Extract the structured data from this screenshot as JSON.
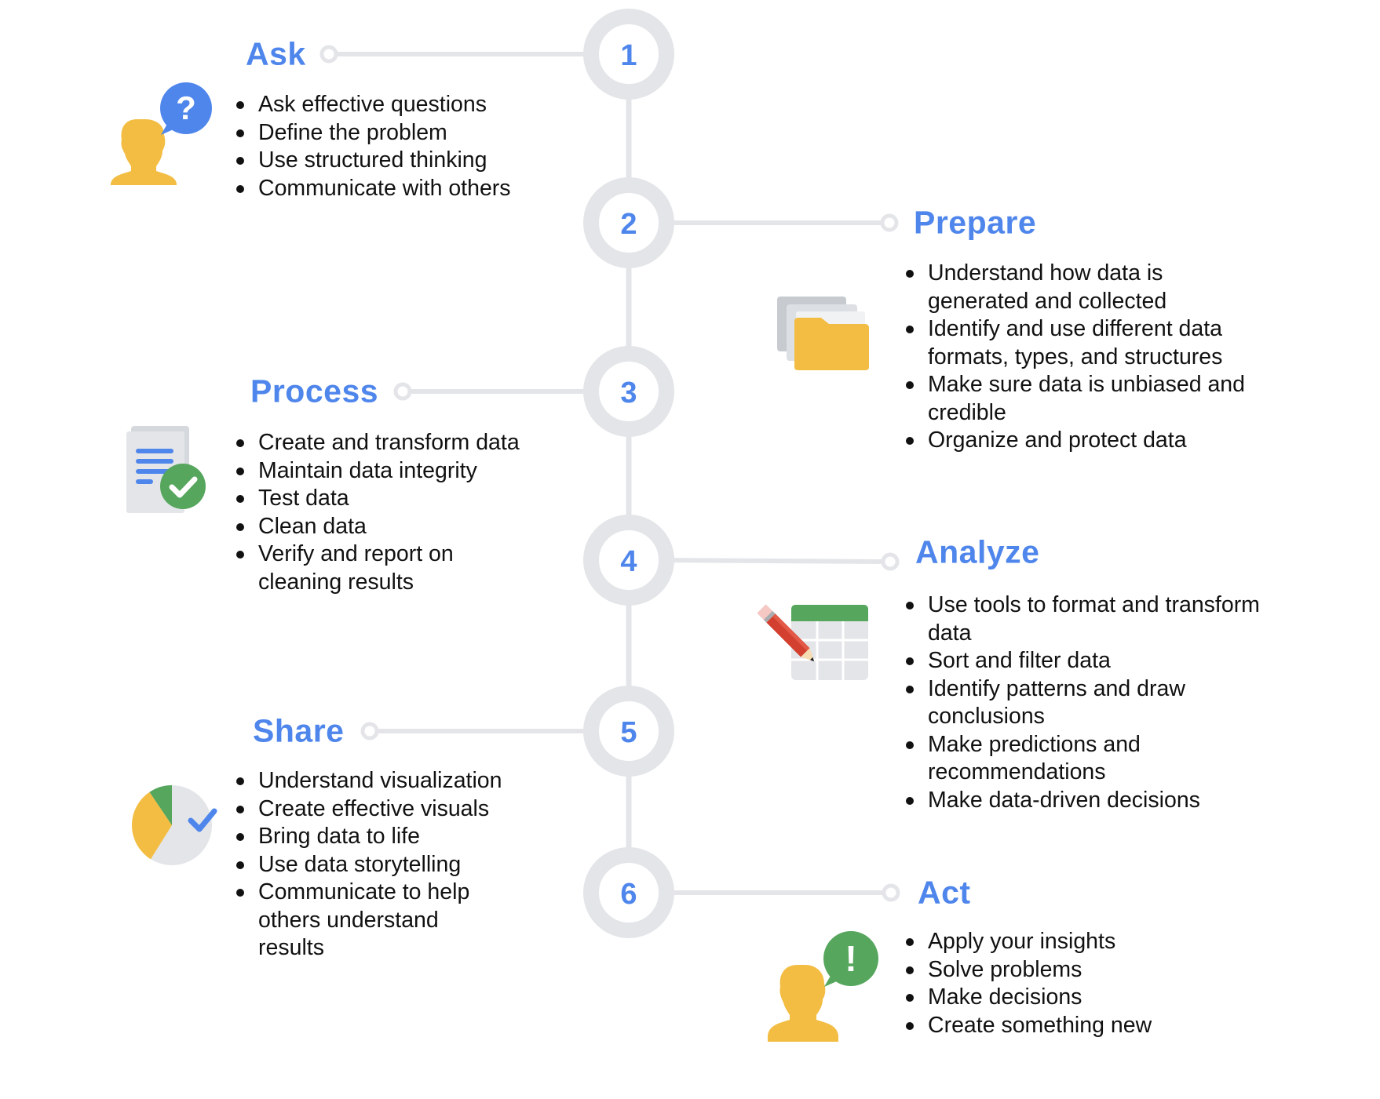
{
  "colors": {
    "accent_blue": "#4F86EC",
    "ring_gray": "#E3E5E8",
    "icon_yellow": "#F2BD42",
    "icon_green": "#56A65D",
    "icon_red": "#D3402F",
    "icon_light_gray": "#E3E5E8",
    "icon_mid_gray": "#C7CBCF",
    "text": "#111111"
  },
  "steps": [
    {
      "number": "1",
      "title": "Ask",
      "icon": "person-question-icon",
      "bullets": [
        "Ask effective questions",
        "Define the problem",
        "Use structured thinking",
        "Communicate with others"
      ]
    },
    {
      "number": "2",
      "title": "Prepare",
      "icon": "folders-icon",
      "bullets": [
        "Understand how data is generated and collected",
        "Identify and use different data formats, types, and structures",
        "Make sure data is unbiased and credible",
        "Organize and protect data"
      ]
    },
    {
      "number": "3",
      "title": "Process",
      "icon": "document-check-icon",
      "bullets": [
        "Create and transform data",
        "Maintain data integrity",
        "Test data",
        "Clean data",
        "Verify and report on cleaning results"
      ]
    },
    {
      "number": "4",
      "title": "Analyze",
      "icon": "spreadsheet-pencil-icon",
      "bullets": [
        "Use tools to format and transform data",
        "Sort and filter data",
        "Identify patterns and draw conclusions",
        "Make predictions and recommendations",
        "Make data-driven decisions"
      ]
    },
    {
      "number": "5",
      "title": "Share",
      "icon": "pie-chart-check-icon",
      "bullets": [
        "Understand visualization",
        "Create effective visuals",
        "Bring data to life",
        "Use data storytelling",
        "Communicate to help others understand results"
      ]
    },
    {
      "number": "6",
      "title": "Act",
      "icon": "person-exclamation-icon",
      "bullets": [
        "Apply your insights",
        "Solve problems",
        "Make decisions",
        "Create something new"
      ]
    }
  ],
  "icon_glyphs": {
    "question": "?",
    "exclamation": "!"
  }
}
